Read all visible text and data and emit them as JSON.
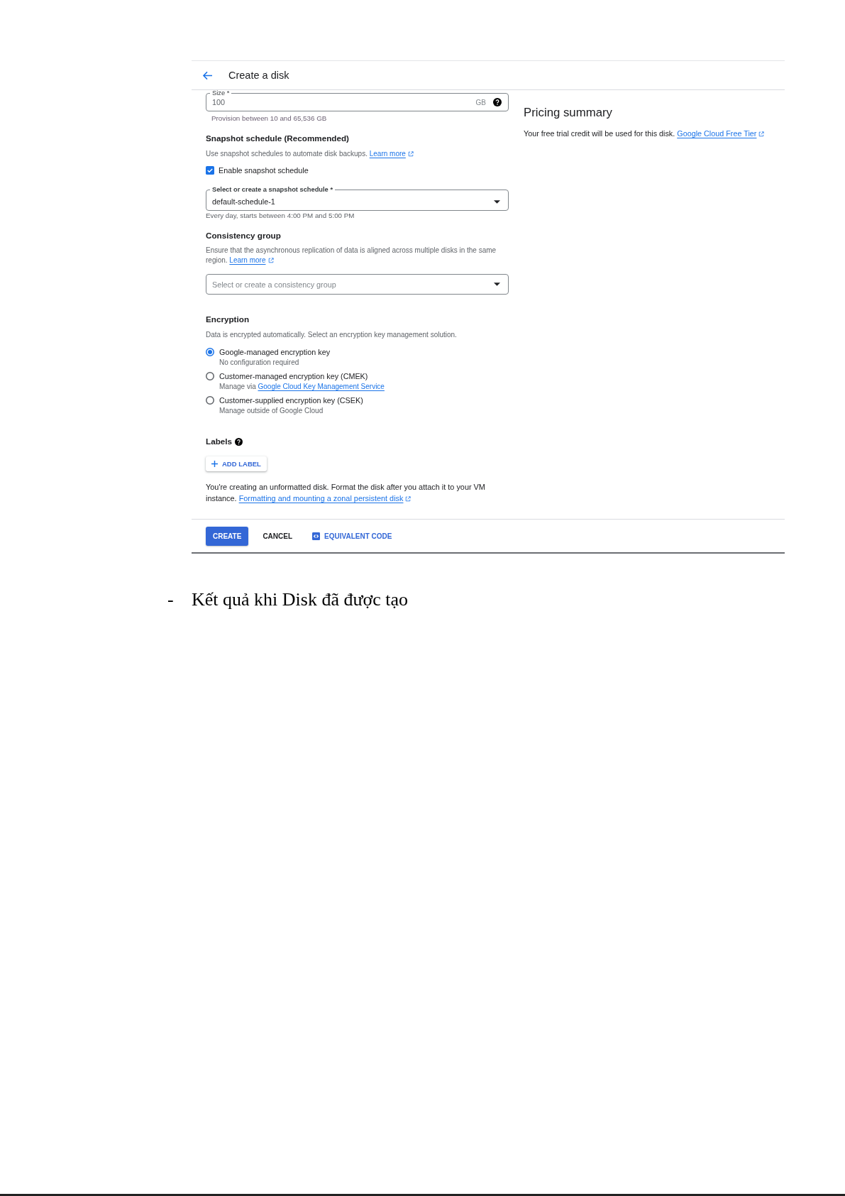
{
  "header": {
    "title": "Create a disk"
  },
  "size_field": {
    "label": "Size *",
    "value": "100",
    "unit": "GB",
    "hint": "Provision between 10 and 65,536 GB"
  },
  "snapshot_schedule": {
    "heading": "Snapshot schedule (Recommended)",
    "description": "Use snapshot schedules to automate disk backups.",
    "link": "Learn more",
    "checkbox": {
      "label": "Enable snapshot schedule",
      "checked": true
    },
    "select": {
      "label": "Select or create a snapshot schedule *",
      "value": "default-schedule-1"
    },
    "hint": "Every day, starts between 4:00 PM and 5:00 PM"
  },
  "consistency_group": {
    "heading": "Consistency group",
    "description": "Ensure that the asynchronous replication of data is aligned across multiple disks in the same region.",
    "link": "Learn more",
    "select": {
      "placeholder": "Select or create a consistency group"
    }
  },
  "encryption": {
    "heading": "Encryption",
    "description": "Data is encrypted automatically. Select an encryption key management solution.",
    "options": [
      {
        "label": "Google-managed encryption key",
        "detail": "No configuration required",
        "selected": true
      },
      {
        "label": "Customer-managed encryption key (CMEK)",
        "detail": "Manage via",
        "link": "Google Cloud Key Management Service",
        "selected": false
      },
      {
        "label": "Customer-supplied encryption key (CSEK)",
        "detail": "Manage outside of Google Cloud",
        "selected": false
      }
    ]
  },
  "labels": {
    "heading": "Labels",
    "add_button": "ADD LABEL"
  },
  "notice": {
    "text": "You're creating an unformatted disk. Format the disk after you attach it to your VM instance.",
    "link": "Formatting and mounting a zonal persistent disk"
  },
  "actions": [
    {
      "label": "CREATE",
      "kind": "primary"
    },
    {
      "label": "CANCEL",
      "kind": "text"
    },
    {
      "label": "EQUIVALENT CODE",
      "kind": "code"
    }
  ],
  "pricing_summary": {
    "heading": "Pricing summary",
    "text": "Your free trial credit will be used for this disk.",
    "link": "Google Cloud Free Tier"
  },
  "caption": {
    "bullet": "-",
    "text": "Kết quả khi Disk đã được tạo"
  }
}
